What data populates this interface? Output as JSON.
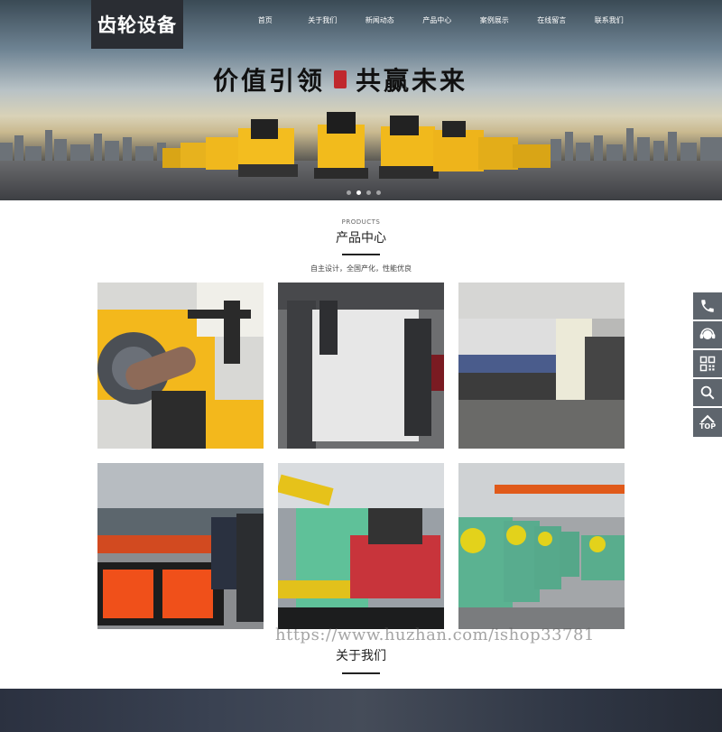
{
  "logo": {
    "text": "齿轮设备"
  },
  "nav": {
    "items": [
      "首页",
      "关于我们",
      "新闻动态",
      "产品中心",
      "案例展示",
      "在线留言",
      "联系我们"
    ]
  },
  "banner": {
    "slogan_left": "价值引领",
    "slogan_right": "共赢未来",
    "slides": 4,
    "active_slide": 1
  },
  "products": {
    "subtitle_en": "PRODUCTS",
    "title": "产品中心",
    "description": "自主设计，全国产化，性能优良",
    "items": [
      {
        "icon": "pipe-cutting-machine-photo"
      },
      {
        "icon": "press-brake-white-photo"
      },
      {
        "icon": "press-brake-workshop-photo"
      },
      {
        "icon": "cnc-plasma-cutter-photo"
      },
      {
        "icon": "scrap-baler-green-photo"
      },
      {
        "icon": "punch-press-row-photo"
      }
    ]
  },
  "about": {
    "title": "关于我们"
  },
  "watermark": {
    "text": "https://www.huzhan.com/ishop33781"
  },
  "sidebar": {
    "phone_icon": "phone-icon",
    "service_icon": "customer-service-icon",
    "qr_icon": "qr-code-icon",
    "search_icon": "search-icon",
    "top_label": "TOP"
  },
  "colors": {
    "accent_dark": "#2a2d33",
    "sidebar": "#5e656d",
    "machine_yellow": "#f3b81c",
    "machine_green": "#4fb694",
    "machine_red": "#e8521d"
  }
}
